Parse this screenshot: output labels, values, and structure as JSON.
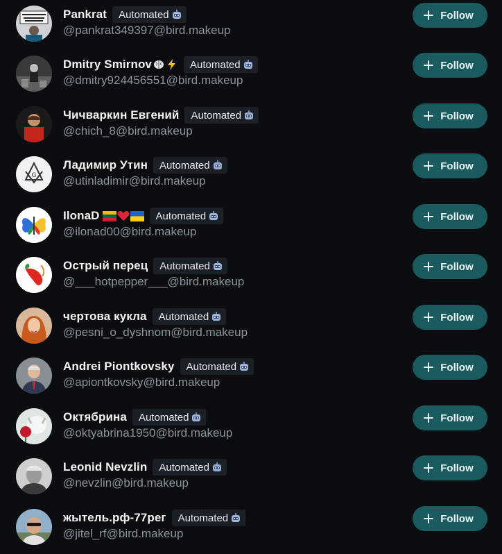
{
  "accounts": [
    {
      "name": "Pankrat",
      "handle": "@pankrat349397@bird.makeup",
      "badge": "Automated",
      "follow_label": "Follow",
      "avatar": "protest-sign-photo"
    },
    {
      "name": "Dmitry Smirnov",
      "name_emoji": [
        "brain-emoji",
        "lightning-emoji"
      ],
      "handle": "@dmitry924456551@bird.makeup",
      "badge": "Automated",
      "follow_label": "Follow",
      "avatar": "bw-person-photo"
    },
    {
      "name": "Чичваркин Евгений",
      "handle": "@chich_8@bird.makeup",
      "badge": "Automated",
      "follow_label": "Follow",
      "avatar": "red-jacket-photo"
    },
    {
      "name": "Ладимир Утин",
      "handle": "@utinladimir@bird.makeup",
      "badge": "Automated",
      "follow_label": "Follow",
      "avatar": "masonic-logo"
    },
    {
      "name": "IlonaD",
      "name_emoji": [
        "lithuania-flag-emoji",
        "red-heart-emoji",
        "ukraine-flag-emoji"
      ],
      "handle": "@ilonad00@bird.makeup",
      "badge": "Automated",
      "follow_label": "Follow",
      "avatar": "butterfly-flag-logo"
    },
    {
      "name": "Острый перец",
      "handle": "@___hotpepper___@bird.makeup",
      "badge": "Automated",
      "follow_label": "Follow",
      "avatar": "chili-pepper-logo"
    },
    {
      "name": "чертова кукла",
      "handle": "@pesni_o_dyshnom@bird.makeup",
      "badge": "Automated",
      "follow_label": "Follow",
      "avatar": "red-hair-portrait"
    },
    {
      "name": "Andrei Piontkovsky",
      "handle": "@apiontkovsky@bird.makeup",
      "badge": "Automated",
      "follow_label": "Follow",
      "avatar": "man-in-suit-photo"
    },
    {
      "name": "Октябрина",
      "handle": "@oktyabrina1950@bird.makeup",
      "badge": "Automated",
      "follow_label": "Follow",
      "avatar": "cat-rose-photo"
    },
    {
      "name": "Leonid Nevzlin",
      "handle": "@nevzlin@bird.makeup",
      "badge": "Automated",
      "follow_label": "Follow",
      "avatar": "grey-hair-man-photo"
    },
    {
      "name": "жытель.рф-77рег",
      "handle": "@jitel_rf@bird.makeup",
      "badge": "Automated",
      "follow_label": "Follow",
      "avatar": "man-sunglasses-photo"
    }
  ],
  "colors": {
    "background": "#0b0d11",
    "follow_button": "#1a5b5f",
    "badge_background": "#1b1f26",
    "name_text": "#f1f3f5",
    "handle_text": "#8b949b"
  }
}
